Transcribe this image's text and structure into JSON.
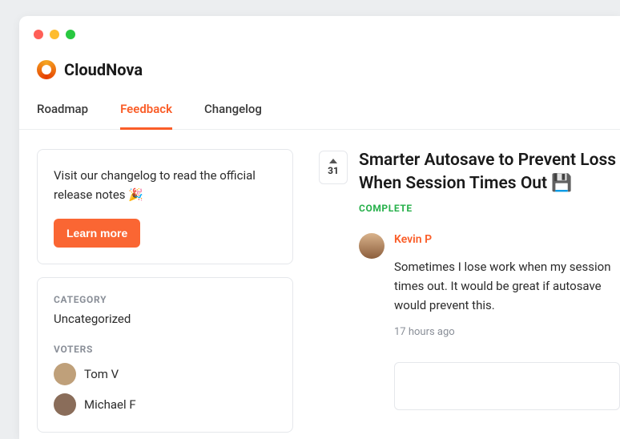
{
  "brand": {
    "name": "CloudNova"
  },
  "tabs": [
    {
      "label": "Roadmap",
      "active": false
    },
    {
      "label": "Feedback",
      "active": true
    },
    {
      "label": "Changelog",
      "active": false
    }
  ],
  "promo": {
    "text": "Visit our changelog to read the official release notes 🎉",
    "cta": "Learn more"
  },
  "meta": {
    "category_label": "CATEGORY",
    "category_value": "Uncategorized",
    "voters_label": "VOTERS",
    "voters": [
      {
        "name": "Tom V"
      },
      {
        "name": "Michael F"
      }
    ]
  },
  "post": {
    "vote_count": "31",
    "title": "Smarter Autosave to Prevent Loss When Session Times Out 💾",
    "status": "COMPLETE",
    "author": "Kevin P",
    "body": "Sometimes I lose work when my session times out. It would be great if autosave would prevent this.",
    "timestamp": "17 hours ago"
  }
}
